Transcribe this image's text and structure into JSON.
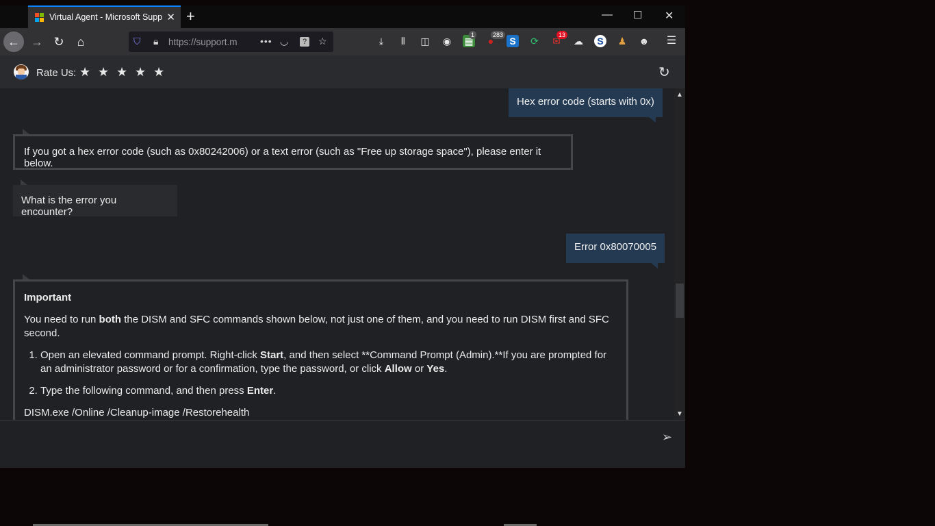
{
  "browser": {
    "tab_title": "Virtual Agent - Microsoft Support",
    "new_tab_label": "+",
    "url": "https://support.m",
    "toolbar_badges": {
      "ext1": "1",
      "ext2": "283",
      "ext3": "13"
    }
  },
  "header": {
    "rate_label": "Rate Us:",
    "stars": [
      "★",
      "★",
      "★",
      "★",
      "★"
    ]
  },
  "messages": {
    "user1": "Hex error code (starts with 0x)",
    "bot1": "If you got a hex error code (such as 0x80242006) or a text error (such as \"Free up storage space\"), please enter it below.",
    "bot2": "What is the error you encounter?",
    "user2": "Error 0x80070005",
    "card": {
      "title": "Important",
      "intro_pre": "You need to run ",
      "intro_bold": "both",
      "intro_post": " the DISM and SFC commands shown below, not just one of them, and you need to run DISM first and SFC second.",
      "step1_pre": "Open an elevated command prompt. Right-click ",
      "step1_start": "Start",
      "step1_mid": ", and then select **Command Prompt (Admin).**If you are prompted for an administrator password or for a confirmation, type the password, or click ",
      "step1_allow": "Allow",
      "step1_or": " or ",
      "step1_yes": "Yes",
      "step1_end": ".",
      "step2_pre": "Type the following command, and then press ",
      "step2_enter": "Enter",
      "step2_end": ".",
      "command": "DISM.exe /Online /Cleanup-image /Restorehealth"
    }
  },
  "input": {
    "placeholder": ""
  },
  "colors": {
    "accent": "#0a84ff",
    "user_bubble": "#243a52",
    "background": "#202124"
  }
}
